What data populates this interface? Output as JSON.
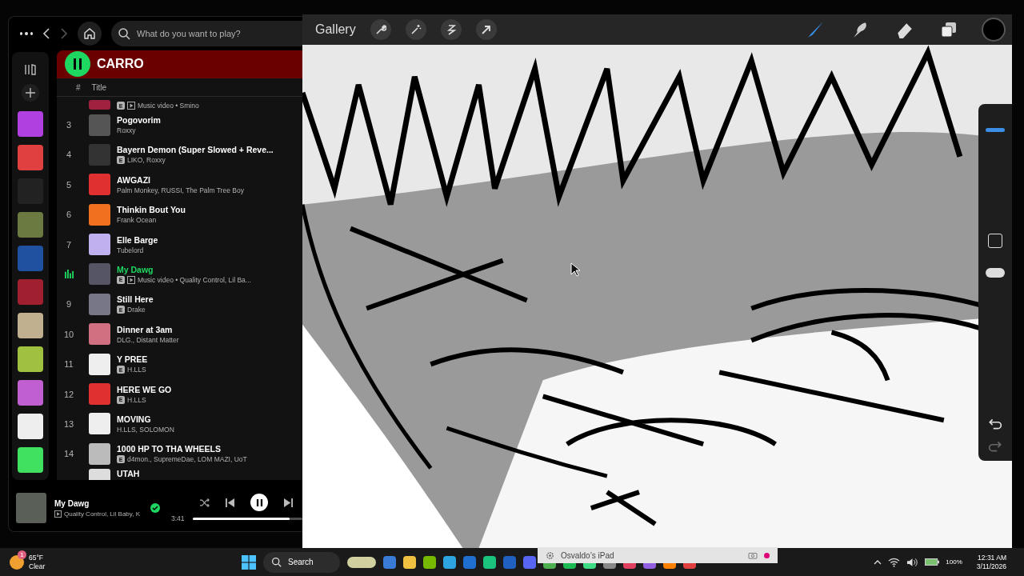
{
  "spotify": {
    "search": {
      "placeholder": "What do you want to play?"
    },
    "playlist": {
      "title": "CARRO",
      "playing": true
    },
    "columns": [
      "#",
      "Title"
    ],
    "tracks": [
      {
        "subtitle": "Music video • Smino",
        "badge": "E",
        "video": true,
        "playing": false
      },
      {
        "number": "3",
        "title": "Pogovorim",
        "subtitle": "Roxxy",
        "video": false,
        "playing": false
      },
      {
        "number": "4",
        "title": "Bayern Demon (Super Slowed + Reve...",
        "subtitle": "LIKO, Roxxy",
        "badge": "E",
        "video": false,
        "playing": false
      },
      {
        "number": "5",
        "title": "AWGAZI",
        "subtitle": "Palm Monkey, RUSSI, The Palm Tree Boy",
        "video": false,
        "playing": false
      },
      {
        "number": "6",
        "title": "Thinkin Bout You",
        "subtitle": "Frank Ocean",
        "video": false,
        "playing": false
      },
      {
        "number": "7",
        "title": "Elle Barge",
        "subtitle": "Tubelord",
        "video": false,
        "playing": false
      },
      {
        "title": "My Dawg",
        "subtitle": "Music video • Quality Control, Lil Ba...",
        "badge": "E",
        "video": true,
        "playing": true
      },
      {
        "number": "9",
        "title": "Still Here",
        "subtitle": "Drake",
        "badge": "E",
        "video": false,
        "playing": false
      },
      {
        "number": "10",
        "title": "Dinner at 3am",
        "subtitle": "DLG., Distant Matter",
        "video": false,
        "playing": false
      },
      {
        "number": "11",
        "title": "Y PREE",
        "subtitle": "H.LLS",
        "badge": "E",
        "video": false,
        "playing": false
      },
      {
        "number": "12",
        "title": "HERE WE GO",
        "subtitle": "H.LLS",
        "badge": "E",
        "video": false,
        "playing": false
      },
      {
        "number": "13",
        "title": "MOVING",
        "subtitle": "H.LLS, SOLOMON",
        "video": false,
        "playing": false
      },
      {
        "number": "14",
        "title": "1000 HP TO THA WHEELS",
        "subtitle": "d4mon., SupremeDae, LOM MAZI, UoT",
        "badge": "E",
        "video": false,
        "playing": false
      },
      {
        "title": "UTAH",
        "playing": false
      }
    ],
    "now_playing": {
      "title": "My Dawg",
      "artists": "Quality Control, Lil Baby, K",
      "video": true,
      "saved": true,
      "playing": true,
      "time": "3:41",
      "level": 0.88
    }
  },
  "procreate": {
    "gallery": "Gallery",
    "brush_size": {
      "level": 0.85
    },
    "opacity": {
      "level": 0.9
    }
  },
  "taskbar": {
    "weather": {
      "temperature": "65°F",
      "condition": "Clear",
      "badge": "1"
    },
    "search": "Search",
    "mirror": {
      "device": "Osvaldo’s iPad"
    },
    "battery": "100%",
    "time": "12:31 AM",
    "date": "3/11/2026"
  }
}
